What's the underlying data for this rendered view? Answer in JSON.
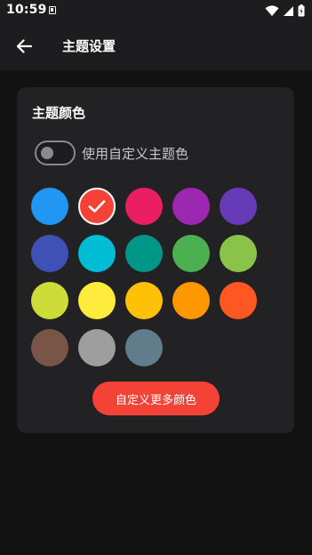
{
  "status_bar": {
    "time": "10:59"
  },
  "app_bar": {
    "title": "主题设置",
    "back_icon": "arrow-left-icon"
  },
  "card": {
    "title": "主题颜色",
    "toggle": {
      "label": "使用自定义主题色",
      "checked": false
    },
    "swatches": [
      {
        "color": "#2196f3",
        "selected": false
      },
      {
        "color": "#f44336",
        "selected": true
      },
      {
        "color": "#e91e63",
        "selected": false
      },
      {
        "color": "#9c27b0",
        "selected": false
      },
      {
        "color": "#673ab7",
        "selected": false
      },
      {
        "color": "#3f51b5",
        "selected": false
      },
      {
        "color": "#00bcd4",
        "selected": false
      },
      {
        "color": "#009688",
        "selected": false
      },
      {
        "color": "#4caf50",
        "selected": false
      },
      {
        "color": "#8bc34a",
        "selected": false
      },
      {
        "color": "#cddc39",
        "selected": false
      },
      {
        "color": "#ffeb3b",
        "selected": false
      },
      {
        "color": "#ffc107",
        "selected": false
      },
      {
        "color": "#ff9800",
        "selected": false
      },
      {
        "color": "#ff5722",
        "selected": false
      },
      {
        "color": "#795548",
        "selected": false
      },
      {
        "color": "#9e9e9e",
        "selected": false
      },
      {
        "color": "#607d8b",
        "selected": false
      }
    ],
    "more_button_label": "自定义更多颜色"
  },
  "colors": {
    "background": "#121212",
    "card": "#222224",
    "accent": "#f44336"
  }
}
